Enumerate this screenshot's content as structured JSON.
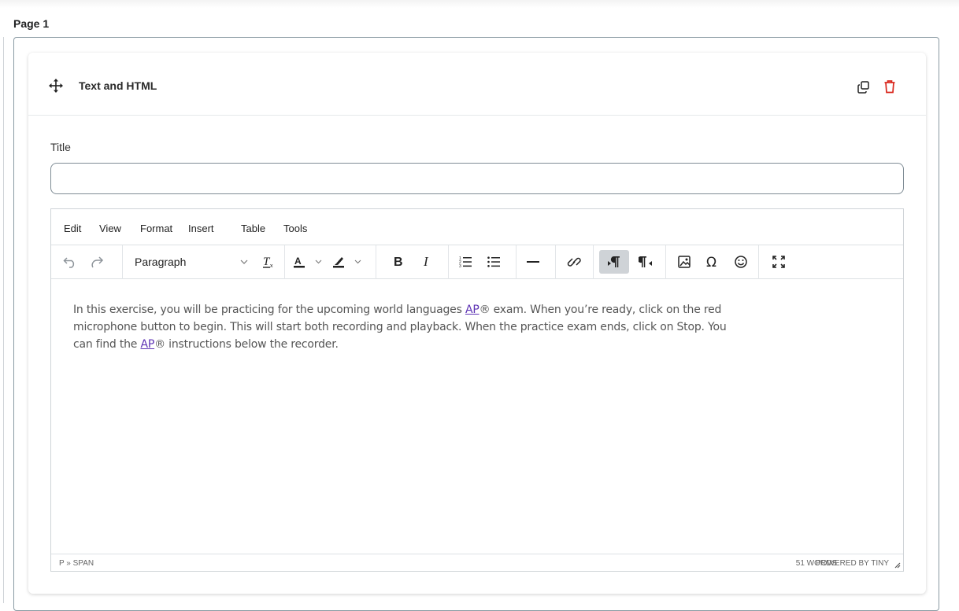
{
  "page": {
    "label": "Page 1"
  },
  "block": {
    "title": "Text and HTML"
  },
  "form": {
    "title_label": "Title",
    "title_value": "",
    "title_placeholder": ""
  },
  "editor": {
    "menu": [
      "Edit",
      "View",
      "Format",
      "Insert",
      "Table",
      "Tools"
    ],
    "block_format": "Paragraph",
    "content": {
      "line1_a": "In this exercise, you will be practicing for the upcoming world languages ",
      "ap": "AP",
      "line1_b": "® exam. When you’re ready, click on the red",
      "line2": "microphone button to begin. This will start both recording and playback. When the practice exam ends, click on Stop. You",
      "line3_a": "can find the ",
      "line3_b": "® instructions below the recorder."
    },
    "status": {
      "path": "P » SPAN",
      "words": "51 WORDS",
      "powered": "POWERED BY TINY"
    }
  },
  "icons": {
    "move": "move-icon",
    "copy": "copy-icon",
    "trash": "trash-icon",
    "undo": "undo-icon",
    "redo": "redo-icon",
    "clear_format": "clear-formatting-icon",
    "text_color": "text-color-icon",
    "highlight": "highlight-icon",
    "bold": "bold-icon",
    "italic": "italic-icon",
    "numbered_list": "numbered-list-icon",
    "bullet_list": "bullet-list-icon",
    "hr": "horizontal-rule-icon",
    "link": "link-icon",
    "ltr": "left-to-right-icon",
    "rtl": "right-to-left-icon",
    "image": "image-icon",
    "special_char": "special-character-icon",
    "emoji": "emoji-icon",
    "fullscreen": "fullscreen-icon"
  },
  "colors": {
    "trash": "#d9261c",
    "link": "#5e33b4",
    "active_button": "#cfd3d7"
  }
}
